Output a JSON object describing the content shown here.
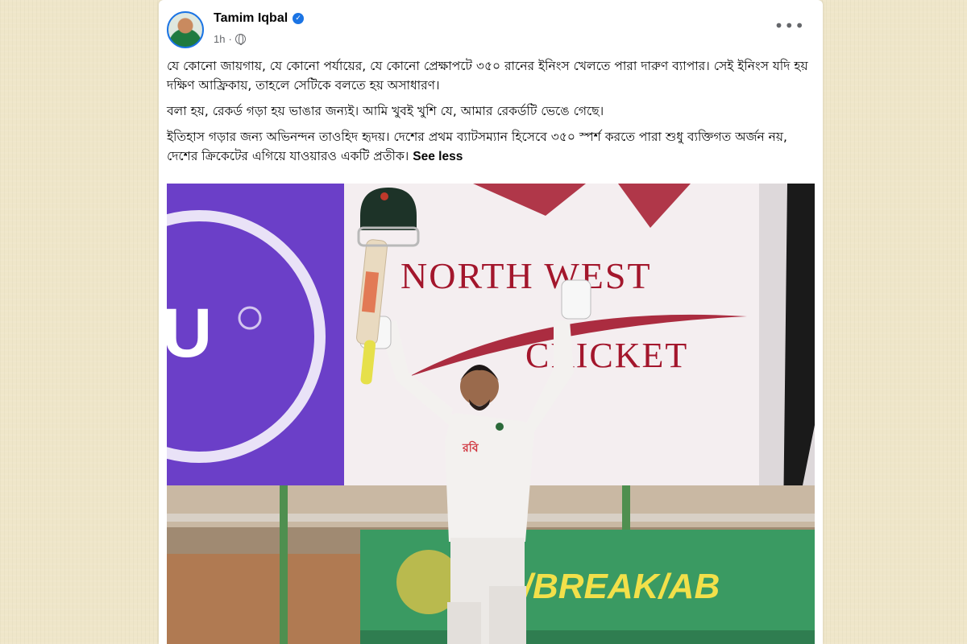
{
  "post": {
    "author": "Tamim Iqbal",
    "verified_icon": "check-icon",
    "time": "1h",
    "separator": "·",
    "privacy_icon": "globe-icon",
    "more_label": "•••",
    "paragraphs": [
      "যে কোনো জায়গায়, যে কোনো পর্যায়ের, যে কোনো প্রেক্ষাপটে ৩৫০ রানের ইনিংস খেলতে পারা দারুণ ব্যাপার। সেই ইনিংস যদি হয় দক্ষিণ আফ্রিকায়, তাহলে সেটিকে বলতে হয় অসাধারণ।",
      "বলা হয়, রেকর্ড গড়া হয় ভাঙার জন্যই। আমি খুবই খুশি যে, আমার রেকর্ডটি ভেঙে গেছে।",
      "ইতিহাস গড়ার জন্য অভিনন্দন তাওহিদ হৃদয়। দেশের প্রথম ব্যাটসম্যান হিসেবে ৩৫০ স্পর্শ করতে পারা শুধু ব্যক্তিগত অর্জন নয়, দেশের ক্রিকেটের এগিয়ে যাওয়ারও একটি প্রতীক।"
    ],
    "see_less": "See less"
  },
  "photo": {
    "banner_line1": "NORTH WEST",
    "banner_line2": "CRICKET",
    "left_banner_text": "U",
    "board_text": "N/BREAK/AB",
    "jersey_text": "রবি"
  },
  "colors": {
    "background": "#efe6c9",
    "verified": "#1b74e4",
    "banner_red": "#a3162c",
    "purple": "#6b3fc8",
    "board_green": "#3a9a62"
  }
}
